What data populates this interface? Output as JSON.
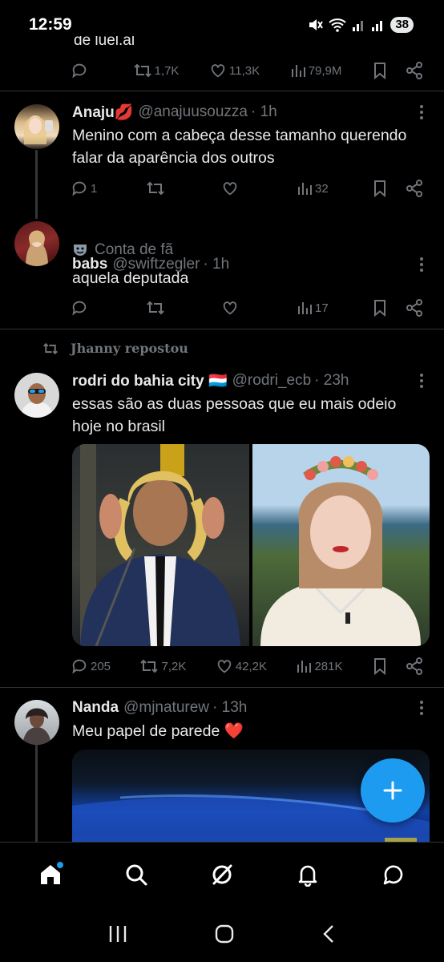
{
  "status_bar": {
    "time": "12:59",
    "battery": "38"
  },
  "previous_tweet": {
    "cutoff_text": "de luel.al",
    "retweets": "1,7K",
    "likes": "11,3K",
    "views": "79,9M"
  },
  "tweets": [
    {
      "name": "Anaju💋",
      "handle": "@anajuusouzza",
      "time": "· 1h",
      "text": "Menino com a cabeça desse tamanho querendo falar da aparência dos outros",
      "replies": "1",
      "retweets": "",
      "likes": "",
      "views": "32"
    },
    {
      "name": "babs",
      "handle": "@swiftzegler",
      "time": "· 1h",
      "badge": "Conta de fã",
      "text": "aquela deputada",
      "replies": "",
      "retweets": "",
      "likes": "",
      "views": "17"
    },
    {
      "repost_label": "Jhanny repostou",
      "name": "rodri do bahia city 🇱🇺",
      "handle": "@rodri_ecb",
      "time": "· 23h",
      "text": "essas são as duas pessoas que eu mais odeio hoje no brasil",
      "replies": "205",
      "retweets": "7,2K",
      "likes": "42,2K",
      "views": "281K"
    },
    {
      "name": "Nanda",
      "handle": "@mjnaturew",
      "time": "· 13h",
      "text": "Meu papel de parede ❤️"
    }
  ],
  "colors": {
    "accent": "#1d9bf0",
    "muted": "#71767b",
    "background": "#000000",
    "divider": "#2f3336"
  },
  "nav": {
    "items": [
      "home-icon",
      "search-icon",
      "grok-icon",
      "notifications-icon",
      "messages-icon"
    ]
  },
  "fab": {
    "icon": "plus-icon"
  }
}
